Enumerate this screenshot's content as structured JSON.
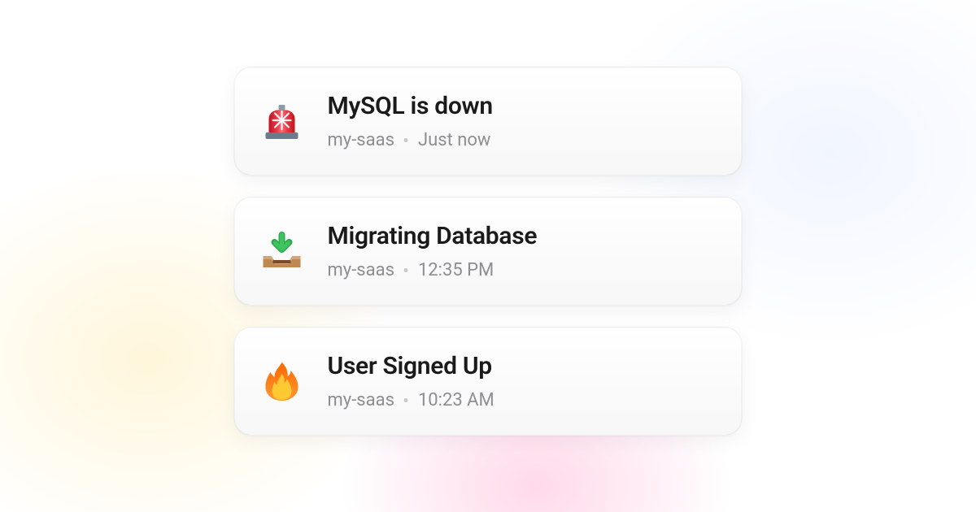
{
  "notifications": [
    {
      "icon": "siren",
      "title": "MySQL is down",
      "project": "my-saas",
      "timestamp": "Just now"
    },
    {
      "icon": "inbox",
      "title": "Migrating Database",
      "project": "my-saas",
      "timestamp": "12:35 PM"
    },
    {
      "icon": "fire",
      "title": "User Signed Up",
      "project": "my-saas",
      "timestamp": "10:23 AM"
    }
  ]
}
